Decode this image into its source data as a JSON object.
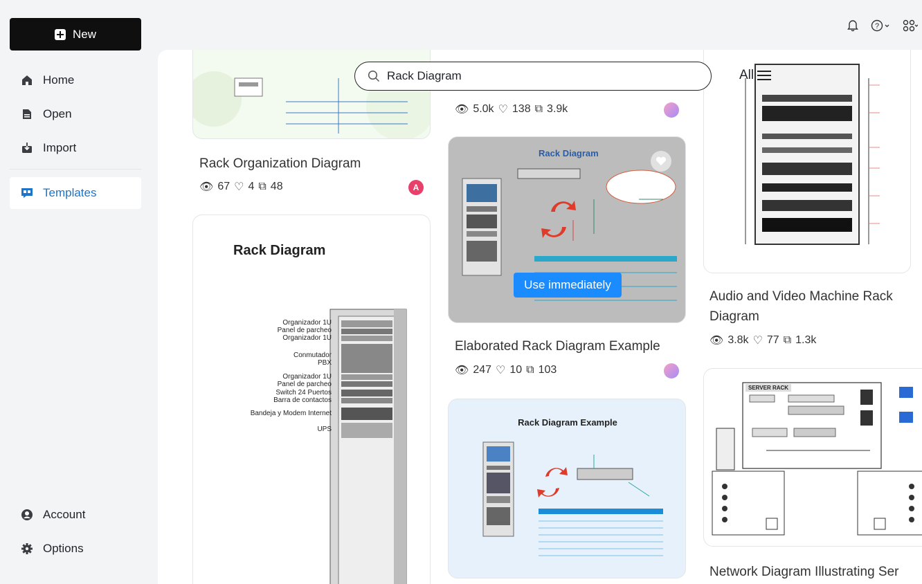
{
  "sidebar": {
    "new_label": "New",
    "items": [
      {
        "label": "Home",
        "icon": "home-icon"
      },
      {
        "label": "Open",
        "icon": "file-icon"
      },
      {
        "label": "Import",
        "icon": "import-icon"
      },
      {
        "label": "Templates",
        "icon": "templates-icon"
      },
      {
        "label": "Account",
        "icon": "account-icon"
      },
      {
        "label": "Options",
        "icon": "gear-icon"
      }
    ],
    "active": "Templates"
  },
  "search": {
    "value": "Rack Diagram",
    "placeholder": ""
  },
  "filter": {
    "label": "All"
  },
  "cards": [
    {
      "title": "Rack Organization Diagram",
      "views": "67",
      "likes": "4",
      "copies": "48",
      "avatar": "A"
    },
    {
      "title": "",
      "views": "5.0k",
      "likes": "138",
      "copies": "3.9k"
    },
    {
      "title": "Elaborated Rack Diagram Example",
      "views": "247",
      "likes": "10",
      "copies": "103",
      "use_label": "Use immediately",
      "image_title": "Rack Diagram"
    },
    {
      "title": "Audio and Video Machine Rack Diagram",
      "views": "3.8k",
      "likes": "77",
      "copies": "1.3k"
    },
    {
      "title": "Network Diagram Illustrating Ser",
      "image_title": "SERVER RACK"
    },
    {
      "image_title": "Rack Diagram",
      "labels": [
        "Organizador 1U",
        "Panel de parcheo",
        "Organizador 1U",
        "Conmutador",
        "PBX",
        "Organizador 1U",
        "Panel de parcheo",
        "Switch 24 Puertos",
        "Barra de contactos",
        "Bandeja y Modem Internet",
        "UPS"
      ]
    },
    {
      "image_title": "Rack Diagram Example"
    }
  ],
  "colors": {
    "accent": "#1d74c9",
    "button": "#1a8cff",
    "dark": "#0f0f0f"
  }
}
